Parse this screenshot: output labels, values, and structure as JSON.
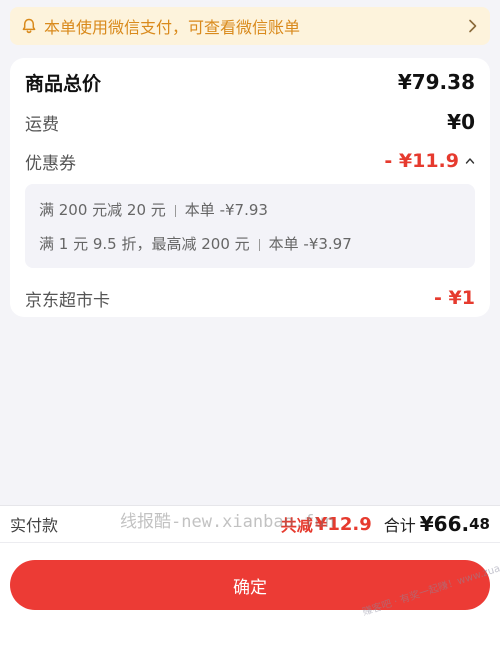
{
  "notice": {
    "text": "本单使用微信支付，可查看微信账单",
    "icon": "bell-icon"
  },
  "summary": {
    "total_label": "商品总价",
    "total_value": "¥79.38",
    "freight_label": "运费",
    "freight_value": "¥0",
    "coupon_label": "优惠券",
    "coupon_value": "- ¥11.9",
    "coupon_details": [
      {
        "rule": "满 200 元减 20 元",
        "deduction": "本单 -¥7.93"
      },
      {
        "rule": "满 1 元 9.5 折，最高减 200 元",
        "deduction": "本单 -¥3.97"
      }
    ],
    "card_label": "京东超市卡",
    "card_value": "- ¥1"
  },
  "payment": {
    "label": "实付款",
    "reduce_label": "共减",
    "reduce_amount": "¥12.9",
    "total_label": "合计",
    "total_int": "¥66.",
    "total_dec": "48"
  },
  "confirm_label": "确定",
  "watermark": "线报酷-new.xianbao.fun",
  "watermark2": "赚客吧 · 有奖一起赚！www.zuanke8.com",
  "colors": {
    "accent": "#ec3b35",
    "price_red": "#e63a2e",
    "notice_bg": "#fdf3dc",
    "notice_text": "#d98a1c"
  }
}
